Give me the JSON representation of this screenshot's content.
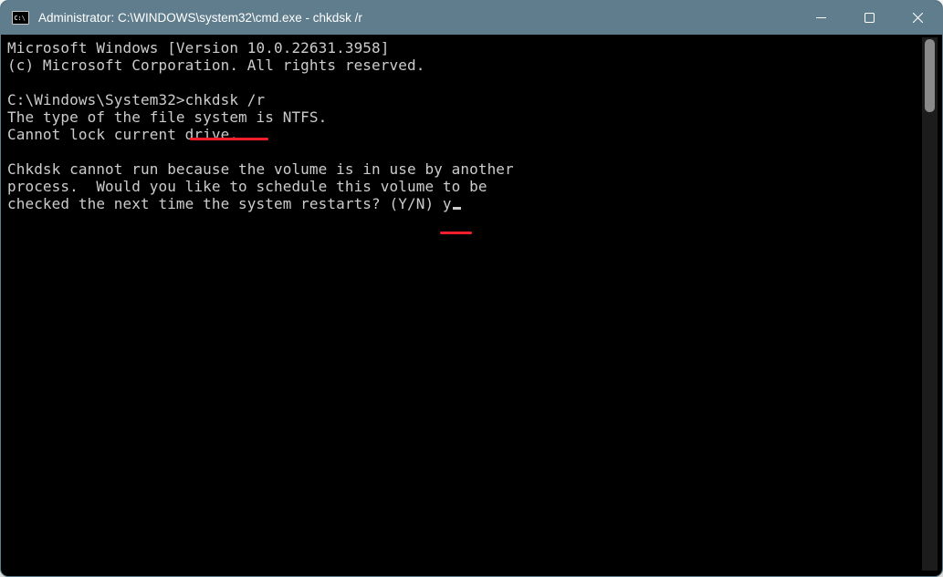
{
  "window": {
    "title": "Administrator: C:\\WINDOWS\\system32\\cmd.exe - chkdsk  /r"
  },
  "terminal": {
    "banner1": "Microsoft Windows [Version 10.0.22631.3958]",
    "banner2": "(c) Microsoft Corporation. All rights reserved.",
    "blank1": "",
    "prompt": "C:\\Windows\\System32>",
    "command": "chkdsk /r",
    "out1": "The type of the file system is NTFS.",
    "out2": "Cannot lock current drive.",
    "blank2": "",
    "out3": "Chkdsk cannot run because the volume is in use by another",
    "out4": "process.  Would you like to schedule this volume to be",
    "out5": "checked the next time the system restarts? (Y/N) ",
    "answer": "y"
  }
}
